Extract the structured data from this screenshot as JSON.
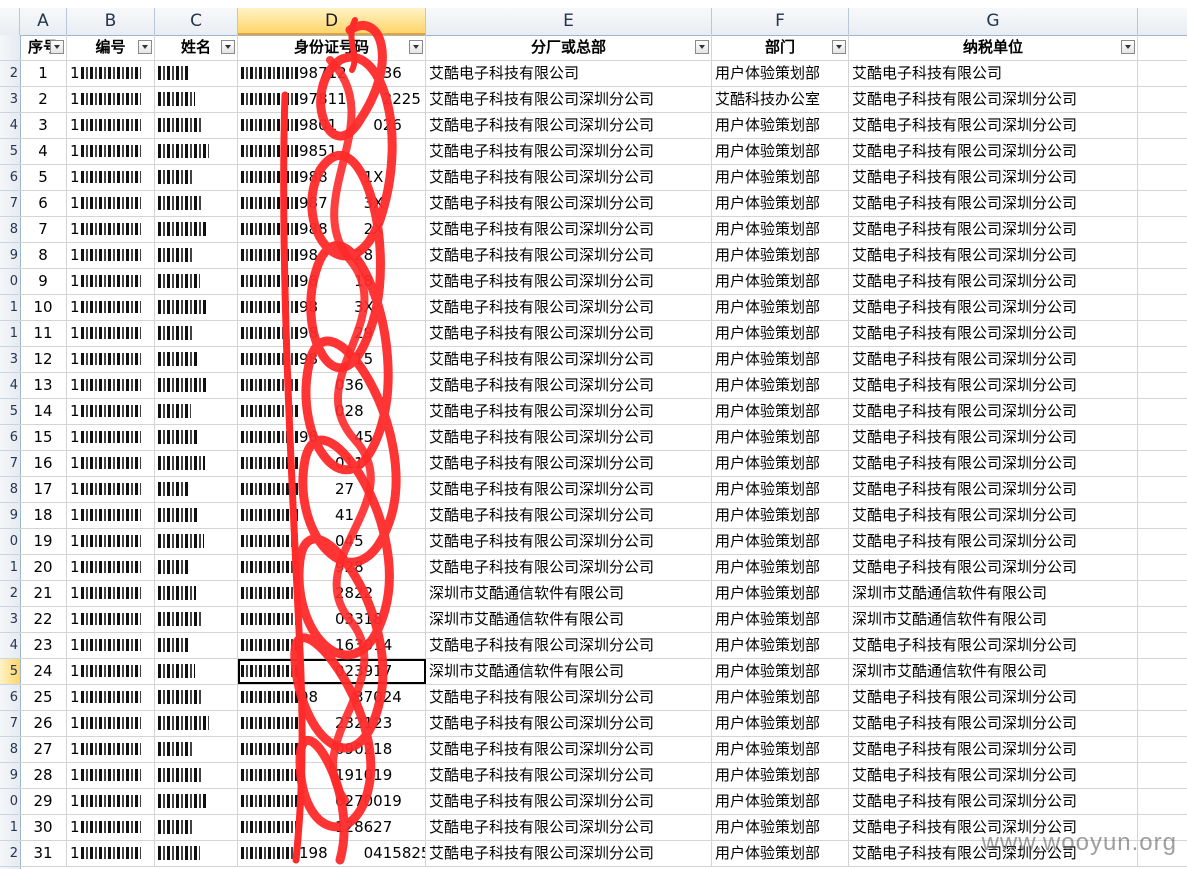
{
  "columns": [
    "A",
    "B",
    "C",
    "D",
    "E",
    "F",
    "G"
  ],
  "selected_column": "D",
  "row_numbers": [
    "",
    "2",
    "3",
    "4",
    "5",
    "6",
    "7",
    "8",
    "9",
    "0",
    "1",
    "1",
    "3",
    "4",
    "5",
    "6",
    "7",
    "8",
    "9",
    "0",
    "1",
    "2",
    "3",
    "4",
    "5",
    "6",
    "7",
    "8",
    "9",
    "0",
    "1",
    "2"
  ],
  "active_row_number": "5",
  "headers": [
    "序号",
    "编号",
    "姓名",
    "身份证号码",
    "分厂或总部",
    "部门",
    "纳税单位"
  ],
  "rows": [
    {
      "seq": "1",
      "code_prefix": "1",
      "id_suffix": "98712",
      "id_tail": "36",
      "branch": "艾酷电子科技有限公司",
      "dept": "用户体验策划部",
      "tax_unit": "艾酷电子科技有限公司"
    },
    {
      "seq": "2",
      "code_prefix": "1",
      "id_suffix": "97811",
      "id_tail": "2225",
      "branch": "艾酷电子科技有限公司深圳分公司",
      "dept": "艾酷科技办公室",
      "tax_unit": "艾酷电子科技有限公司深圳分公司"
    },
    {
      "seq": "3",
      "code_prefix": "1",
      "id_suffix": "9801",
      "id_tail": "026",
      "branch": "艾酷电子科技有限公司深圳分公司",
      "dept": "用户体验策划部",
      "tax_unit": "艾酷电子科技有限公司深圳分公司"
    },
    {
      "seq": "4",
      "code_prefix": "1",
      "id_suffix": "9851",
      "id_tail": "",
      "branch": "艾酷电子科技有限公司深圳分公司",
      "dept": "用户体验策划部",
      "tax_unit": "艾酷电子科技有限公司深圳分公司"
    },
    {
      "seq": "5",
      "code_prefix": "1",
      "id_suffix": "988",
      "id_tail": "1X",
      "branch": "艾酷电子科技有限公司深圳分公司",
      "dept": "用户体验策划部",
      "tax_unit": "艾酷电子科技有限公司深圳分公司"
    },
    {
      "seq": "6",
      "code_prefix": "1",
      "id_suffix": "987",
      "id_tail": "3X",
      "branch": "艾酷电子科技有限公司深圳分公司",
      "dept": "用户体验策划部",
      "tax_unit": "艾酷电子科技有限公司深圳分公司"
    },
    {
      "seq": "7",
      "code_prefix": "1",
      "id_suffix": "988",
      "id_tail": "2X",
      "branch": "艾酷电子科技有限公司深圳分公司",
      "dept": "用户体验策划部",
      "tax_unit": "艾酷电子科技有限公司深圳分公司"
    },
    {
      "seq": "8",
      "code_prefix": "1",
      "id_suffix": "98",
      "id_tail": "28",
      "branch": "艾酷电子科技有限公司深圳分公司",
      "dept": "用户体验策划部",
      "tax_unit": "艾酷电子科技有限公司深圳分公司"
    },
    {
      "seq": "9",
      "code_prefix": "1",
      "id_suffix": "98",
      "id_tail": "18",
      "branch": "艾酷电子科技有限公司深圳分公司",
      "dept": "用户体验策划部",
      "tax_unit": "艾酷电子科技有限公司深圳分公司"
    },
    {
      "seq": "10",
      "code_prefix": "1",
      "id_suffix": "98",
      "id_tail": "3X",
      "branch": "艾酷电子科技有限公司深圳分公司",
      "dept": "用户体验策划部",
      "tax_unit": "艾酷电子科技有限公司深圳分公司"
    },
    {
      "seq": "11",
      "code_prefix": "1",
      "id_suffix": "98",
      "id_tail": "29",
      "branch": "艾酷电子科技有限公司深圳分公司",
      "dept": "用户体验策划部",
      "tax_unit": "艾酷电子科技有限公司深圳分公司"
    },
    {
      "seq": "12",
      "code_prefix": "1",
      "id_suffix": "98",
      "id_tail": "15",
      "branch": "艾酷电子科技有限公司深圳分公司",
      "dept": "用户体验策划部",
      "tax_unit": "艾酷电子科技有限公司深圳分公司"
    },
    {
      "seq": "13",
      "code_prefix": "1",
      "id_suffix": "",
      "id_tail": "036",
      "branch": "艾酷电子科技有限公司深圳分公司",
      "dept": "用户体验策划部",
      "tax_unit": "艾酷电子科技有限公司深圳分公司"
    },
    {
      "seq": "14",
      "code_prefix": "1",
      "id_suffix": "",
      "id_tail": "028",
      "branch": "艾酷电子科技有限公司深圳分公司",
      "dept": "用户体验策划部",
      "tax_unit": "艾酷电子科技有限公司深圳分公司"
    },
    {
      "seq": "15",
      "code_prefix": "1",
      "id_suffix": "98",
      "id_tail": "45",
      "branch": "艾酷电子科技有限公司深圳分公司",
      "dept": "用户体验策划部",
      "tax_unit": "艾酷电子科技有限公司深圳分公司"
    },
    {
      "seq": "16",
      "code_prefix": "1",
      "id_suffix": "",
      "id_tail": "011",
      "branch": "艾酷电子科技有限公司深圳分公司",
      "dept": "用户体验策划部",
      "tax_unit": "艾酷电子科技有限公司深圳分公司"
    },
    {
      "seq": "17",
      "code_prefix": "1",
      "id_suffix": "",
      "id_tail": "27",
      "branch": "艾酷电子科技有限公司深圳分公司",
      "dept": "用户体验策划部",
      "tax_unit": "艾酷电子科技有限公司深圳分公司"
    },
    {
      "seq": "18",
      "code_prefix": "1",
      "id_suffix": "",
      "id_tail": "41",
      "branch": "艾酷电子科技有限公司深圳分公司",
      "dept": "用户体验策划部",
      "tax_unit": "艾酷电子科技有限公司深圳分公司"
    },
    {
      "seq": "19",
      "code_prefix": "1",
      "id_suffix": "",
      "id_tail": "045",
      "branch": "艾酷电子科技有限公司深圳分公司",
      "dept": "用户体验策划部",
      "tax_unit": "艾酷电子科技有限公司深圳分公司"
    },
    {
      "seq": "20",
      "code_prefix": "1",
      "id_suffix": "",
      "id_tail": "928",
      "branch": "艾酷电子科技有限公司深圳分公司",
      "dept": "用户体验策划部",
      "tax_unit": "艾酷电子科技有限公司深圳分公司"
    },
    {
      "seq": "21",
      "code_prefix": "1",
      "id_suffix": "",
      "id_tail": "2822",
      "branch": "深圳市艾酷通信软件有限公司",
      "dept": "用户体验策划部",
      "tax_unit": "深圳市艾酷通信软件有限公司"
    },
    {
      "seq": "22",
      "code_prefix": "1",
      "id_suffix": "",
      "id_tail": "03318",
      "branch": "深圳市艾酷通信软件有限公司",
      "dept": "用户体验策划部",
      "tax_unit": "深圳市艾酷通信软件有限公司"
    },
    {
      "seq": "23",
      "code_prefix": "1",
      "id_suffix": "",
      "id_tail": "163014",
      "branch": "艾酷电子科技有限公司深圳分公司",
      "dept": "用户体验策划部",
      "tax_unit": "艾酷电子科技有限公司深圳分公司"
    },
    {
      "seq": "24",
      "code_prefix": "1",
      "id_suffix": "",
      "id_tail": "023917",
      "branch": "深圳市艾酷通信软件有限公司",
      "dept": "用户体验策划部",
      "tax_unit": "深圳市艾酷通信软件有限公司"
    },
    {
      "seq": "25",
      "code_prefix": "1",
      "id_suffix": "98",
      "id_tail": "37024",
      "branch": "艾酷电子科技有限公司深圳分公司",
      "dept": "用户体验策划部",
      "tax_unit": "艾酷电子科技有限公司深圳分公司"
    },
    {
      "seq": "26",
      "code_prefix": "1",
      "id_suffix": "",
      "id_tail": "232123",
      "branch": "艾酷电子科技有限公司深圳分公司",
      "dept": "用户体验策划部",
      "tax_unit": "艾酷电子科技有限公司深圳分公司"
    },
    {
      "seq": "27",
      "code_prefix": "1",
      "id_suffix": "",
      "id_tail": "090218",
      "branch": "艾酷电子科技有限公司深圳分公司",
      "dept": "用户体验策划部",
      "tax_unit": "艾酷电子科技有限公司深圳分公司"
    },
    {
      "seq": "28",
      "code_prefix": "1",
      "id_suffix": "",
      "id_tail": "191019",
      "branch": "艾酷电子科技有限公司深圳分公司",
      "dept": "用户体验策划部",
      "tax_unit": "艾酷电子科技有限公司深圳分公司"
    },
    {
      "seq": "29",
      "code_prefix": "1",
      "id_suffix": "",
      "id_tail": "6270019",
      "branch": "艾酷电子科技有限公司深圳分公司",
      "dept": "用户体验策划部",
      "tax_unit": "艾酷电子科技有限公司深圳分公司"
    },
    {
      "seq": "30",
      "code_prefix": "1",
      "id_suffix": "",
      "id_tail": "128627",
      "branch": "艾酷电子科技有限公司深圳分公司",
      "dept": "用户体验策划部",
      "tax_unit": "艾酷电子科技有限公司深圳分公司"
    },
    {
      "seq": "31",
      "code_prefix": "1",
      "id_suffix": "198",
      "id_tail": "04158259",
      "branch": "艾酷电子科技有限公司深圳分公司",
      "dept": "用户体验策划部",
      "tax_unit": "艾酷电子科技有限公司深圳分公司"
    }
  ],
  "active_cell_row": 24,
  "watermark": "www.wooyun.org",
  "colors": {
    "scribble": "#ff2a2a",
    "selected_header": "#ffd56a",
    "header_text": "#23364d"
  }
}
